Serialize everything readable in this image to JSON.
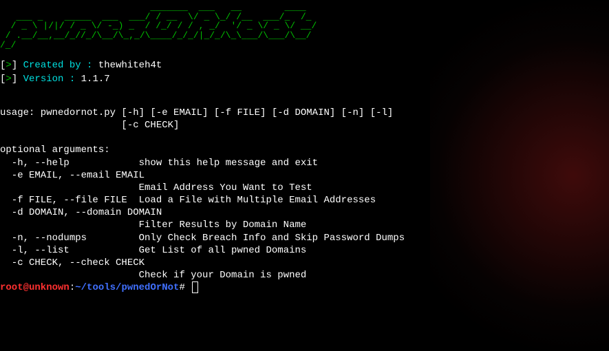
{
  "ascii_art": "                            _______  ___   __        ____\n   ___ _    _____  ___  ___/ / __  \\/ _ \\_/ /__  ___/_  /_\n  / _ \\ |/|/ / _ \\/ -_) _  / /_/ / / , _/  '/ _ \\/ _ \\/ __/\n / .__/__,__/_//_/\\__/\\_,_/\\____/_/_/|_/_/\\_\\___/\\___/\\__/\n/_/",
  "info": {
    "created_label": "Created by :",
    "created_value": "thewhiteh4t",
    "version_label": "Version    :",
    "version_value": "1.1.7"
  },
  "usage": {
    "line1": "usage: pwnedornot.py [-h] [-e EMAIL] [-f FILE] [-d DOMAIN] [-n] [-l]",
    "line2": "                     [-c CHECK]"
  },
  "optional_header": "optional arguments:",
  "args": {
    "help": "  -h, --help            show this help message and exit",
    "email1": "  -e EMAIL, --email EMAIL",
    "email2": "                        Email Address You Want to Test",
    "file": "  -f FILE, --file FILE  Load a File with Multiple Email Addresses",
    "domain1": "  -d DOMAIN, --domain DOMAIN",
    "domain2": "                        Filter Results by Domain Name",
    "nodumps": "  -n, --nodumps         Only Check Breach Info and Skip Password Dumps",
    "list": "  -l, --list            Get List of all pwned Domains",
    "check1": "  -c CHECK, --check CHECK",
    "check2": "                        Check if your Domain is pwned"
  },
  "prompt": {
    "user_host": "root@unknown",
    "colon": ":",
    "path": "~/tools/pwnedOrNot",
    "hash": "#"
  }
}
